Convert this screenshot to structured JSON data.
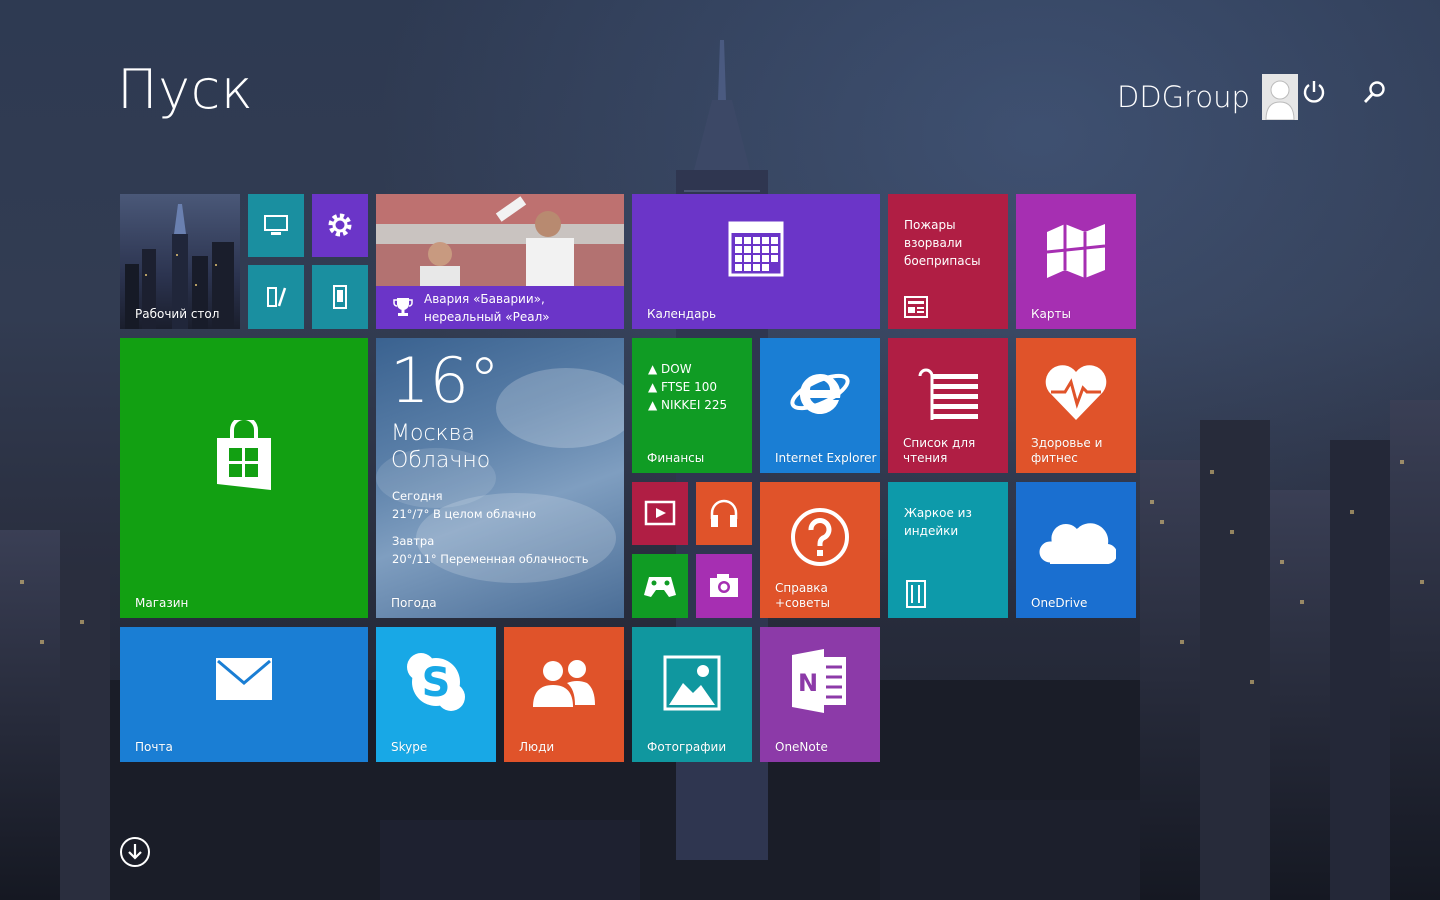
{
  "header": {
    "title": "Пуск",
    "user_name": "DDGroup"
  },
  "icons": {
    "power": "power-icon",
    "search": "search-icon",
    "apps_down": "arrow-down-circle-icon"
  },
  "tiles": {
    "desktop": {
      "label": "Рабочий стол"
    },
    "sport": {
      "headline_line1": "Авария «Баварии»,",
      "headline_line2": "нереальный «Реал»"
    },
    "calendar": {
      "label": "Календарь"
    },
    "news": {
      "line1": "Пожары",
      "line2": "взорвали",
      "line3": "боеприпасы"
    },
    "maps": {
      "label": "Карты"
    },
    "store": {
      "label": "Магазин"
    },
    "weather": {
      "temp": "16°",
      "city": "Москва",
      "condition": "Облачно",
      "today_label": "Сегодня",
      "today_forecast": "21°/7° В целом облачно",
      "tomorrow_label": "Завтра",
      "tomorrow_forecast": "20°/11° Переменная облачность",
      "label": "Погода"
    },
    "finance": {
      "items": [
        "▲ DOW",
        "▲ FTSE 100",
        "▲ NIKKEI 225"
      ],
      "label": "Финансы"
    },
    "ie": {
      "label": "Internet Explorer"
    },
    "reading": {
      "label_line1": "Список для",
      "label_line2": "чтения"
    },
    "health": {
      "label_line1": "Здоровье и",
      "label_line2": "фитнес"
    },
    "help": {
      "label_line1": "Справка",
      "label_line2": "+советы"
    },
    "food": {
      "line1": "Жаркое из",
      "line2": "индейки"
    },
    "onedrive": {
      "label": "OneDrive"
    },
    "mail": {
      "label": "Почта"
    },
    "skype": {
      "label": "Skype"
    },
    "people": {
      "label": "Люди"
    },
    "photos": {
      "label": "Фотографии"
    },
    "onenote": {
      "label": "OneNote"
    }
  },
  "colors": {
    "calendar": "#6b35c8",
    "news": "#b01e44",
    "maps": "#a62fb2",
    "store": "#12a012",
    "finance": "#109c24",
    "ie": "#1a7ed4",
    "reading": "#b01e44",
    "health": "#e0532a",
    "help": "#e0532a",
    "food": "#0d9aaa",
    "onedrive": "#1a6fd0",
    "mail": "#1a7ed4",
    "skype": "#18a8e6",
    "people": "#e0532a",
    "photos": "#10979f",
    "onenote": "#8c3aa8"
  }
}
